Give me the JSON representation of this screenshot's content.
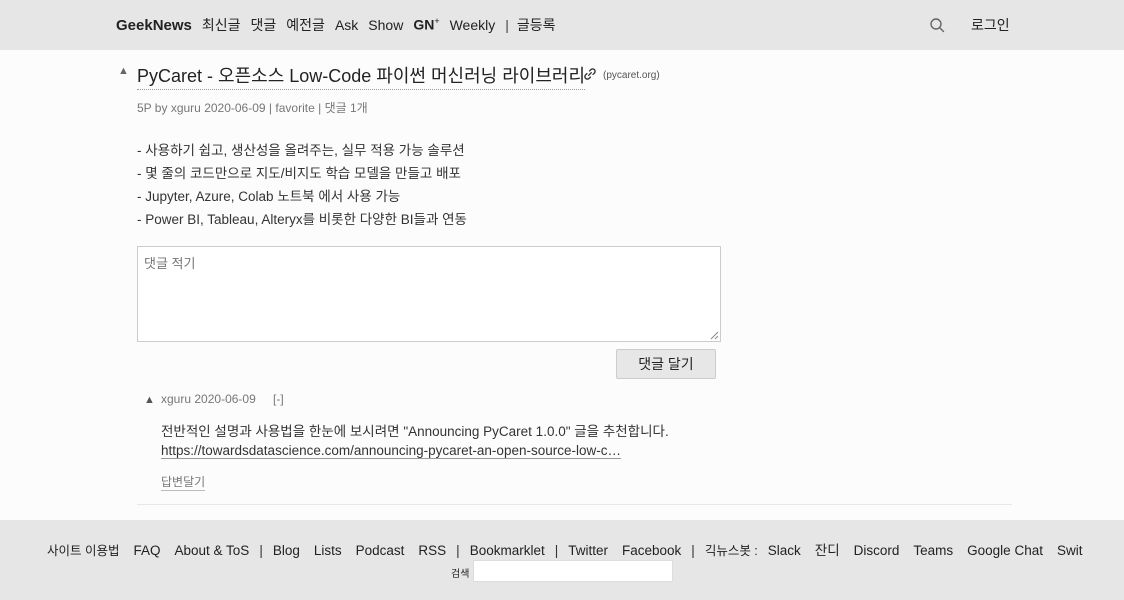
{
  "nav": {
    "brand": "GeekNews",
    "items": [
      "최신글",
      "댓글",
      "예전글",
      "Ask",
      "Show"
    ],
    "gn_label": "GN",
    "gn_sup": "+",
    "weekly": "Weekly",
    "separator": "|",
    "submit": "글등록",
    "login": "로그인",
    "search_icon": "search-icon"
  },
  "topic": {
    "vote_glyph": "▲",
    "title": "PyCaret - 오픈소스 Low-Code 파이썬 머신러닝 라이브러리",
    "link_icon": "link-icon",
    "domain": "(pycaret.org)",
    "meta": {
      "points": "5P by",
      "user": "xguru",
      "date": "2020-06-09",
      "sep": "|",
      "favorite": "favorite",
      "comments": "댓글 1개"
    },
    "content": [
      "- 사용하기 쉽고, 생산성을 올려주는, 실무 적용 가능 솔루션",
      "- 몇 줄의 코드만으로 지도/비지도 학습 모델을 만들고 배포",
      "- Jupyter, Azure, Colab 노트북 에서 사용 가능",
      "- Power BI, Tableau, Alteryx를 비롯한 다양한 BI들과 연동"
    ]
  },
  "comment_form": {
    "placeholder": "댓글 적기",
    "submit_label": "댓글 달기"
  },
  "comment": {
    "vote_glyph": "▲",
    "user": "xguru",
    "date": "2020-06-09",
    "collapse": "[-]",
    "text": "전반적인 설명과 사용법을 한눈에 보시려면 \"Announcing PyCaret 1.0.0\" 글을 추천합니다.",
    "link": "https://towardsdatascience.com/announcing-pycaret-an-open-source-low-c…",
    "reply": "답변달기"
  },
  "footer": {
    "links_a": [
      "사이트 이용법",
      "FAQ",
      "About & ToS"
    ],
    "links_b": [
      "Blog",
      "Lists",
      "Podcast",
      "RSS"
    ],
    "links_c": [
      "Bookmarklet"
    ],
    "links_d": [
      "Twitter",
      "Facebook"
    ],
    "bot_label": "긱뉴스봇 :",
    "links_e": [
      "Slack",
      "잔디",
      "Discord",
      "Teams",
      "Google Chat",
      "Swit"
    ],
    "separator": "|",
    "search_label": "검색"
  }
}
